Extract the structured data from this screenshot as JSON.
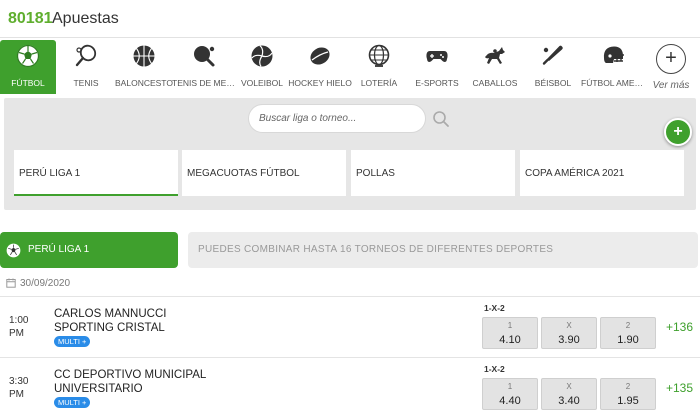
{
  "header": {
    "brand_number": "80181",
    "title": "Apuestas"
  },
  "sports": [
    {
      "label": "Fútbol",
      "icon": "soccer-ball-icon",
      "active": true
    },
    {
      "label": "Tenis",
      "icon": "tennis-racket-icon"
    },
    {
      "label": "Baloncesto",
      "icon": "basketball-icon"
    },
    {
      "label": "Tenis de mesa",
      "icon": "ping-pong-icon"
    },
    {
      "label": "Voleibol",
      "icon": "volleyball-icon"
    },
    {
      "label": "Hockey hielo",
      "icon": "hockey-puck-icon"
    },
    {
      "label": "Lotería",
      "icon": "lottery-globe-icon"
    },
    {
      "label": "E-Sports",
      "icon": "gamepad-icon"
    },
    {
      "label": "Caballos",
      "icon": "horse-icon"
    },
    {
      "label": "Béisbol",
      "icon": "baseball-bat-icon"
    },
    {
      "label": "Fútbol americano",
      "icon": "football-helmet-icon"
    }
  ],
  "more_sports": {
    "symbol": "+",
    "label": "Ver más"
  },
  "search": {
    "placeholder": "Buscar liga o torneo..."
  },
  "fab": {
    "symbol": "+"
  },
  "leagues": [
    {
      "label": "PERÚ LIGA 1",
      "active": true
    },
    {
      "label": "MEGACUOTAS FÚTBOL"
    },
    {
      "label": "POLLAS"
    },
    {
      "label": "COPA AMÉRICA 2021"
    }
  ],
  "selected_league": {
    "label": "PERÚ LIGA 1"
  },
  "combine_text": "PUEDES COMBINAR HASTA 16 TORNEOS DE DIFERENTES DEPORTES",
  "date": "30/09/2020",
  "matches": [
    {
      "time": "1:00 PM",
      "home": "Carlos Mannucci",
      "away": "Sporting Cristal",
      "badge": "MULTI +",
      "market": "1-X-2",
      "odds": [
        {
          "k": "1",
          "v": "4.10"
        },
        {
          "k": "X",
          "v": "3.90"
        },
        {
          "k": "2",
          "v": "1.90"
        }
      ],
      "more": "+136"
    },
    {
      "time": "3:30 PM",
      "home": "CC Deportivo Municipal",
      "away": "Universitario",
      "badge": "MULTI +",
      "market": "1-X-2",
      "odds": [
        {
          "k": "1",
          "v": "4.40"
        },
        {
          "k": "X",
          "v": "3.40"
        },
        {
          "k": "2",
          "v": "1.95"
        }
      ],
      "more": "+135"
    }
  ],
  "colors": {
    "accent": "#3fa02d",
    "brand_number": "#5fae2e",
    "badge": "#2a8ce8"
  }
}
